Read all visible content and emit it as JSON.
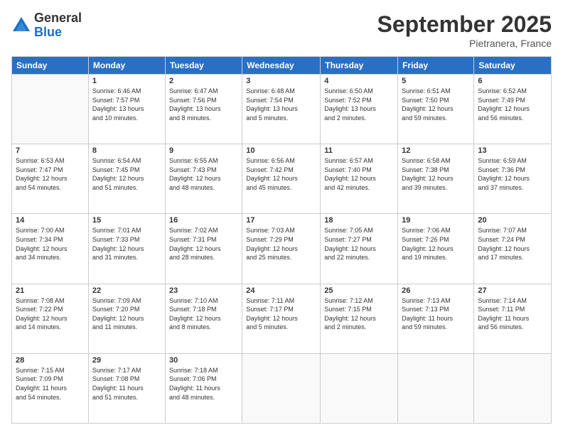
{
  "logo": {
    "general": "General",
    "blue": "Blue"
  },
  "title": "September 2025",
  "subtitle": "Pietranera, France",
  "headers": [
    "Sunday",
    "Monday",
    "Tuesday",
    "Wednesday",
    "Thursday",
    "Friday",
    "Saturday"
  ],
  "weeks": [
    [
      {
        "day": "",
        "info": ""
      },
      {
        "day": "1",
        "info": "Sunrise: 6:46 AM\nSunset: 7:57 PM\nDaylight: 13 hours\nand 10 minutes."
      },
      {
        "day": "2",
        "info": "Sunrise: 6:47 AM\nSunset: 7:56 PM\nDaylight: 13 hours\nand 8 minutes."
      },
      {
        "day": "3",
        "info": "Sunrise: 6:48 AM\nSunset: 7:54 PM\nDaylight: 13 hours\nand 5 minutes."
      },
      {
        "day": "4",
        "info": "Sunrise: 6:50 AM\nSunset: 7:52 PM\nDaylight: 13 hours\nand 2 minutes."
      },
      {
        "day": "5",
        "info": "Sunrise: 6:51 AM\nSunset: 7:50 PM\nDaylight: 12 hours\nand 59 minutes."
      },
      {
        "day": "6",
        "info": "Sunrise: 6:52 AM\nSunset: 7:49 PM\nDaylight: 12 hours\nand 56 minutes."
      }
    ],
    [
      {
        "day": "7",
        "info": "Sunrise: 6:53 AM\nSunset: 7:47 PM\nDaylight: 12 hours\nand 54 minutes."
      },
      {
        "day": "8",
        "info": "Sunrise: 6:54 AM\nSunset: 7:45 PM\nDaylight: 12 hours\nand 51 minutes."
      },
      {
        "day": "9",
        "info": "Sunrise: 6:55 AM\nSunset: 7:43 PM\nDaylight: 12 hours\nand 48 minutes."
      },
      {
        "day": "10",
        "info": "Sunrise: 6:56 AM\nSunset: 7:42 PM\nDaylight: 12 hours\nand 45 minutes."
      },
      {
        "day": "11",
        "info": "Sunrise: 6:57 AM\nSunset: 7:40 PM\nDaylight: 12 hours\nand 42 minutes."
      },
      {
        "day": "12",
        "info": "Sunrise: 6:58 AM\nSunset: 7:38 PM\nDaylight: 12 hours\nand 39 minutes."
      },
      {
        "day": "13",
        "info": "Sunrise: 6:59 AM\nSunset: 7:36 PM\nDaylight: 12 hours\nand 37 minutes."
      }
    ],
    [
      {
        "day": "14",
        "info": "Sunrise: 7:00 AM\nSunset: 7:34 PM\nDaylight: 12 hours\nand 34 minutes."
      },
      {
        "day": "15",
        "info": "Sunrise: 7:01 AM\nSunset: 7:33 PM\nDaylight: 12 hours\nand 31 minutes."
      },
      {
        "day": "16",
        "info": "Sunrise: 7:02 AM\nSunset: 7:31 PM\nDaylight: 12 hours\nand 28 minutes."
      },
      {
        "day": "17",
        "info": "Sunrise: 7:03 AM\nSunset: 7:29 PM\nDaylight: 12 hours\nand 25 minutes."
      },
      {
        "day": "18",
        "info": "Sunrise: 7:05 AM\nSunset: 7:27 PM\nDaylight: 12 hours\nand 22 minutes."
      },
      {
        "day": "19",
        "info": "Sunrise: 7:06 AM\nSunset: 7:26 PM\nDaylight: 12 hours\nand 19 minutes."
      },
      {
        "day": "20",
        "info": "Sunrise: 7:07 AM\nSunset: 7:24 PM\nDaylight: 12 hours\nand 17 minutes."
      }
    ],
    [
      {
        "day": "21",
        "info": "Sunrise: 7:08 AM\nSunset: 7:22 PM\nDaylight: 12 hours\nand 14 minutes."
      },
      {
        "day": "22",
        "info": "Sunrise: 7:09 AM\nSunset: 7:20 PM\nDaylight: 12 hours\nand 11 minutes."
      },
      {
        "day": "23",
        "info": "Sunrise: 7:10 AM\nSunset: 7:18 PM\nDaylight: 12 hours\nand 8 minutes."
      },
      {
        "day": "24",
        "info": "Sunrise: 7:11 AM\nSunset: 7:17 PM\nDaylight: 12 hours\nand 5 minutes."
      },
      {
        "day": "25",
        "info": "Sunrise: 7:12 AM\nSunset: 7:15 PM\nDaylight: 12 hours\nand 2 minutes."
      },
      {
        "day": "26",
        "info": "Sunrise: 7:13 AM\nSunset: 7:13 PM\nDaylight: 11 hours\nand 59 minutes."
      },
      {
        "day": "27",
        "info": "Sunrise: 7:14 AM\nSunset: 7:11 PM\nDaylight: 11 hours\nand 56 minutes."
      }
    ],
    [
      {
        "day": "28",
        "info": "Sunrise: 7:15 AM\nSunset: 7:09 PM\nDaylight: 11 hours\nand 54 minutes."
      },
      {
        "day": "29",
        "info": "Sunrise: 7:17 AM\nSunset: 7:08 PM\nDaylight: 11 hours\nand 51 minutes."
      },
      {
        "day": "30",
        "info": "Sunrise: 7:18 AM\nSunset: 7:06 PM\nDaylight: 11 hours\nand 48 minutes."
      },
      {
        "day": "",
        "info": ""
      },
      {
        "day": "",
        "info": ""
      },
      {
        "day": "",
        "info": ""
      },
      {
        "day": "",
        "info": ""
      }
    ]
  ]
}
